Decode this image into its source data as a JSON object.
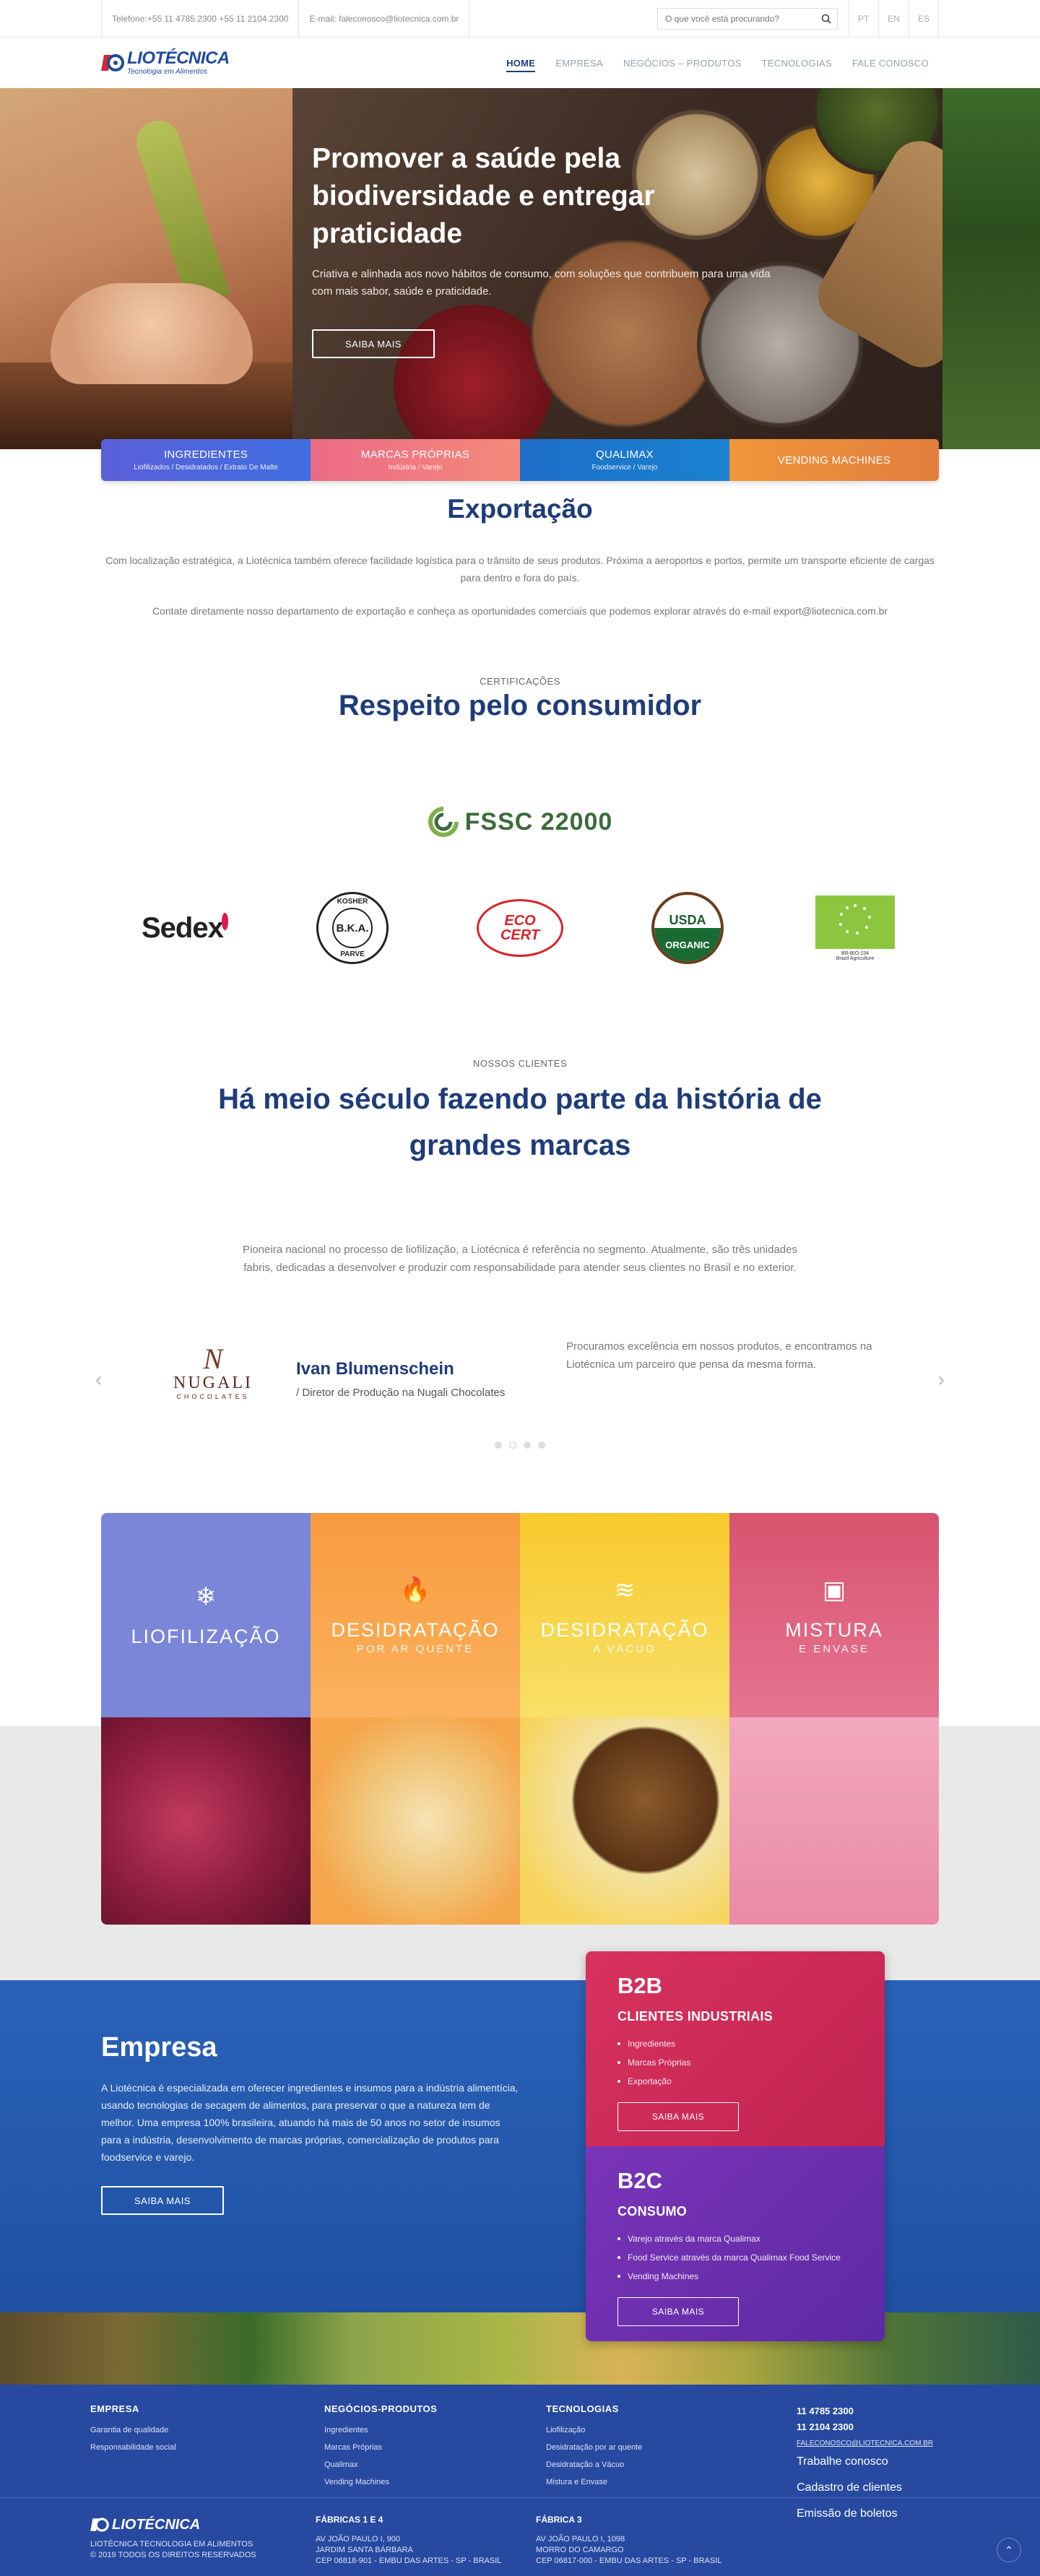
{
  "topbar": {
    "phone": "Telefone:+55 11 4785.2300 +55 11 2104.2300",
    "email": "E-mail: faleconosco@liotecnica.com.br",
    "search_placeholder": "O que você está procurando?",
    "languages": [
      "PT",
      "EN",
      "ES"
    ]
  },
  "brand": {
    "name": "LIOTÉCNICA",
    "tagline": "Tecnologia em Alimentos",
    "color": "#1f4a9c"
  },
  "nav": {
    "items": [
      "HOME",
      "EMPRESA",
      "NEGÓCIOS – PRODUTOS",
      "TECNOLOGIAS",
      "FALE CONOSCO"
    ],
    "active": "HOME"
  },
  "hero": {
    "title": "Promover a saúde pela biodiversidade e entregar praticidade",
    "subtitle": "Criativa e alinhada aos novo hábitos de consumo, com soluções que contribuem para uma vida com mais sabor, saúde e praticidade.",
    "cta": "SAIBA MAIS"
  },
  "categories": [
    {
      "title": "INGREDIENTES",
      "sub": "Liofilizados / Desidratados / Extrato De Malte",
      "color": "#4a5bd4"
    },
    {
      "title": "MARCAS PRÓPRIAS",
      "sub": "Indústria / Varejo",
      "color": "#f07a80"
    },
    {
      "title": "QUALIMAX",
      "sub": "Foodservice / Varejo",
      "color": "#1e73c6"
    },
    {
      "title": "VENDING MACHINES",
      "sub": "",
      "color": "#ea8a3a"
    }
  ],
  "export": {
    "title": "Exportação",
    "p1": "Com localização estratégica, a Liotécnica também oferece facilidade logística para o trânsito de seus produtos. Próxima a aeroportos e portos, permite um transporte eficiente de cargas para dentro e fora do país.",
    "p2": "Contate diretamente nosso departamento de exportação e conheça as oportunidades comerciais que podemos explorar através do e-mail export@liotecnica.com.br"
  },
  "certs": {
    "eyebrow": "CERTIFICAÇÕES",
    "title": "Respeito pelo consumidor",
    "fssc": "FSSC 22000",
    "seals": {
      "sedex": "Sedex",
      "kosher_top": "KOSHER",
      "kosher_mid": "B.K.A.",
      "kosher_bot": "PARVE",
      "ecocert": "ECO CERT",
      "usda_top": "USDA",
      "usda_bot": "ORGANIC",
      "eu_code": "BR-BIO-154",
      "eu_origin": "Brazil Agriculture"
    }
  },
  "clients": {
    "eyebrow": "NOSSOS CLIENTES",
    "title": "Há meio século fazendo parte da história de grandes marcas",
    "text": "Pioneira nacional no processo de liofilização, a Liotécnica é referência no segmento. Atualmente, são três unidades fabris, dedicadas a desenvolver e produzir com responsabilidade para atender seus clientes no Brasil e no exterior.",
    "testimonial": {
      "brand": "NUGALI",
      "brand_sub": "CHOCOLATES",
      "name": "Ivan Blumenschein",
      "role": "/ Diretor de Produção na Nugali Chocolates",
      "quote": "Procuramos excelência em nossos produtos, e encontramos na Liotécnica um parceiro que pensa da mesma forma."
    },
    "slides": 4,
    "active_slide": 2
  },
  "processes": [
    {
      "title": "LIOFILIZAÇÃO",
      "sub": "",
      "icon": "snowflake-icon",
      "color": "#7a86d8"
    },
    {
      "title": "DESIDRATAÇÃO",
      "sub": "POR AR QUENTE",
      "icon": "flame-icon",
      "color": "#f89a3f"
    },
    {
      "title": "DESIDRATAÇÃO",
      "sub": "A VÁCUO",
      "icon": "wind-icon",
      "color": "#f7c92c"
    },
    {
      "title": "MISTURA",
      "sub": "E ENVASE",
      "icon": "box-icon",
      "color": "#d8546f"
    }
  ],
  "empresa": {
    "title": "Empresa",
    "text": "A Liotécnica é especializada em oferecer ingredientes e insumos para a indústria alimentícia, usando tecnologias de secagem de alimentos, para preservar o que a natureza tem de melhor. Uma empresa 100% brasileira, atuando há mais de 50 anos no setor de insumos para a indústria, desenvolvimento de marcas próprias, comercialização de produtos para foodservice e varejo.",
    "cta": "SAIBA MAIS"
  },
  "b2b": {
    "title": "B2B",
    "subtitle": "CLIENTES INDUSTRIAIS",
    "items": [
      "Ingredientes",
      "Marcas Próprias",
      "Exportação"
    ],
    "cta": "SAIBA MAIS"
  },
  "b2c": {
    "title": "B2C",
    "subtitle": "CONSUMO",
    "items": [
      "Varejo através da marca Qualimax",
      "Food Service através da marca Qualimax Food Service",
      "Vending Machines"
    ],
    "cta": "SAIBA MAIS"
  },
  "footer": {
    "col1": {
      "title": "EMPRESA",
      "links": [
        "Garantia de qualidade",
        "Responsabilidade social"
      ]
    },
    "col2": {
      "title": "NEGÓCIOS-PRODUTOS",
      "links": [
        "Ingredientes",
        "Marcas Próprias",
        "Qualimax",
        "Vending Machines"
      ]
    },
    "col3": {
      "title": "TECNOLOGIAS",
      "links": [
        "Liofilização",
        "Desidratação por ar quente",
        "Desidratação a Vácuo",
        "Mistura e Envase"
      ]
    },
    "contact": {
      "tel1": "11 4785 2300",
      "tel2": "11 2104 2300",
      "email": "FALECONOSCO@LIOTECNICA.COM.BR",
      "links": [
        "Trabalhe conosco",
        "Cadastro de clientes",
        "Emissão de boletos"
      ]
    },
    "company": "LIOTÉCNICA TECNOLOGIA EM ALIMENTOS",
    "copyright": "© 2019 TODOS OS DIREITOS RESERVADOS",
    "factory1": {
      "title": "FÁBRICAS 1 E 4",
      "l1": "AV JOÃO PAULO I, 900",
      "l2": "JARDIM SANTA BÁRBARA",
      "l3": "CEP 06818-901 - EMBU DAS ARTES - SP - BRASIL"
    },
    "factory3": {
      "title": "FÁBRICA 3",
      "l1": "AV JOÃO PAULO I, 1098",
      "l2": "MORRO DO CAMARGO",
      "l3": "CEP 06817-000 - EMBU DAS ARTES - SP - BRASIL"
    }
  }
}
